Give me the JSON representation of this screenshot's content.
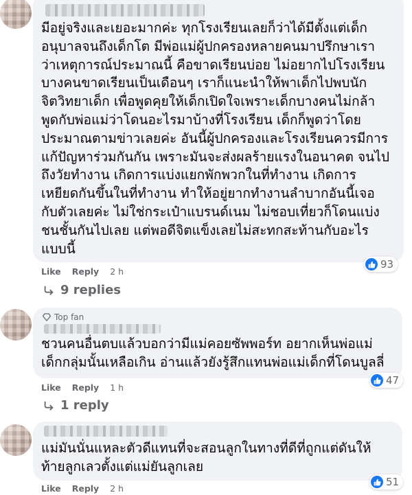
{
  "comments": [
    {
      "lines": [
        "มีอยู่จริงและเยอะมากค่ะ ทุกโรงเรียนเลยก็ว่าได้มีตั้งแต่เด็ก",
        "อนุบาลจนถึงเด็กโต มีพ่อแม่ผู้ปกครองหลายคนมาปรึกษาเรา",
        "ว่าเหตุการณ์ประมาณนี้ คือขาดเรียนบ่อย ไม่อยากไปโรงเรียน",
        "บางคนขาดเรียนเป็นเดือนๆ เราก็แนะนำให้พาเด็กไปพบนัก",
        "จิตวิทยาเด็ก เพื่อพูดคุยให้เด็กเปิดใจเพราะเด็กบางคนไม่กล้า",
        "พูดกับพ่อแม่ว่าโดนอะไรมาบ้างที่โรงเรียน เด็กก็พูดว่าโดย",
        "ประมาณตามข่าวเลยค่ะ อันนี้ผู้ปกครองและโรงเรียนควรมีการ",
        "แก้ปัญหาร่วมกันกัน เพราะมันจะส่งผลร้ายแรงในอนาคต จนไป",
        "ถึงวัยทำงาน เกิดการแบ่งแยกพักพวกในที่ทำงาน เกิดการ",
        "เหยียดกันขึ้นในที่ทำงาน ทำให้อยู่ยากทำงานลำบากอันนี้เจอ",
        "กับตัวเลยค่ะ ไม่ใช่กระเป๋าแบรนด์เนม ไม่ชอบเที่ยวก็โดนแบ่ง",
        "ชนชั้นกันไปเลย แต่พอดีจิตแข็งเลยไม่สะทกสะท้านกับอะไร",
        "แบบนี้"
      ],
      "like_label": "Like",
      "reply_label": "Reply",
      "time": "2 h",
      "reaction_count": "93",
      "replies_label": "9 replies"
    },
    {
      "badge": "Top fan",
      "lines": [
        "ชวนคนอื่นตบแล้วบอกว่ามีแม่คอยซัพพอร์ท อยากเห็นพ่อแม่",
        "เด็กกลุ่มนั้นเหลือเกิน อ่านแล้วยังรู้สึกแทนพ่อแม่เด็กที่โดนบูลลี่"
      ],
      "like_label": "Like",
      "reply_label": "Reply",
      "time": "1 h",
      "reaction_count": "47",
      "replies_label": "1 reply"
    },
    {
      "lines": [
        "แม่มันนั่นแหละตัวดีแทนที่จะสอนลูกในทางที่ดีที่ถูกแต่ดันให้",
        "ท้ายลูกเลวตั้งแต่แม่ยันลูกเลย"
      ],
      "like_label": "Like",
      "reply_label": "Reply",
      "time": "2 h",
      "reaction_count": "51"
    }
  ],
  "colors": {
    "bubble": "#f0f2f5",
    "meta": "#65676b",
    "like": "#1877f2"
  },
  "icons": [
    "reply-arrow-icon",
    "like-thumb-icon",
    "top-fan-diamond-icon"
  ]
}
